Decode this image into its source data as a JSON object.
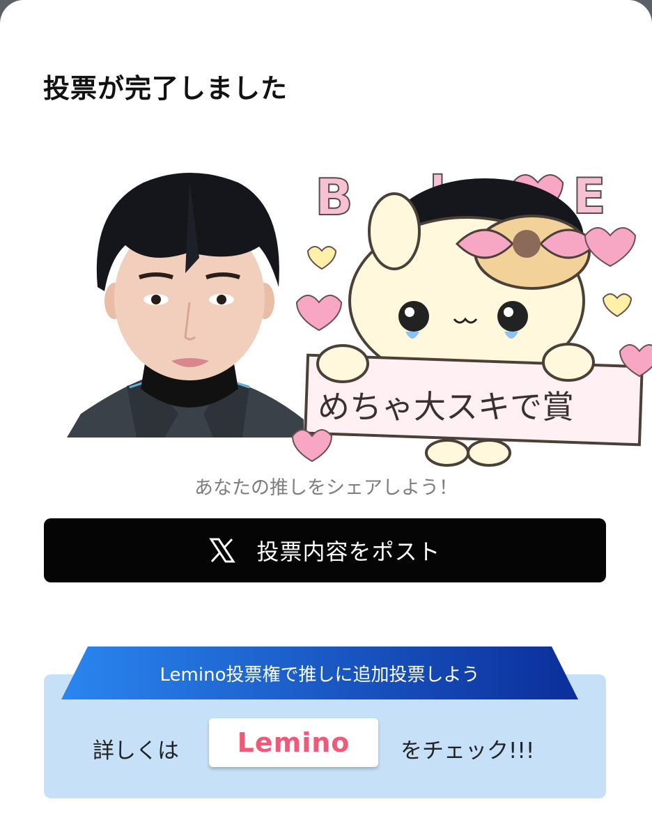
{
  "modal": {
    "title": "投票が完了しました"
  },
  "share_image": {
    "sticker_text_top": "B LOVE",
    "sticker_text_board": "めちゃ大スキで賞"
  },
  "share": {
    "caption": "あなたの推しをシェアしよう！",
    "post_button_label": "投票内容をポスト",
    "post_button_icon": "x-logo-icon"
  },
  "promo": {
    "ribbon_text": "Lemino投票権で推しに追加投票しよう",
    "prefix_text": "詳しくは",
    "logo_text": "Lemino",
    "suffix_text": "をチェック!!!"
  },
  "colors": {
    "post_button_bg": "#050505",
    "promo_bg": "#c6e0f8",
    "ribbon_start": "#1e6fe0",
    "ribbon_end": "#0b2e9a",
    "lemino_orange": "#f7a23b",
    "lemino_pink": "#e8417f"
  }
}
